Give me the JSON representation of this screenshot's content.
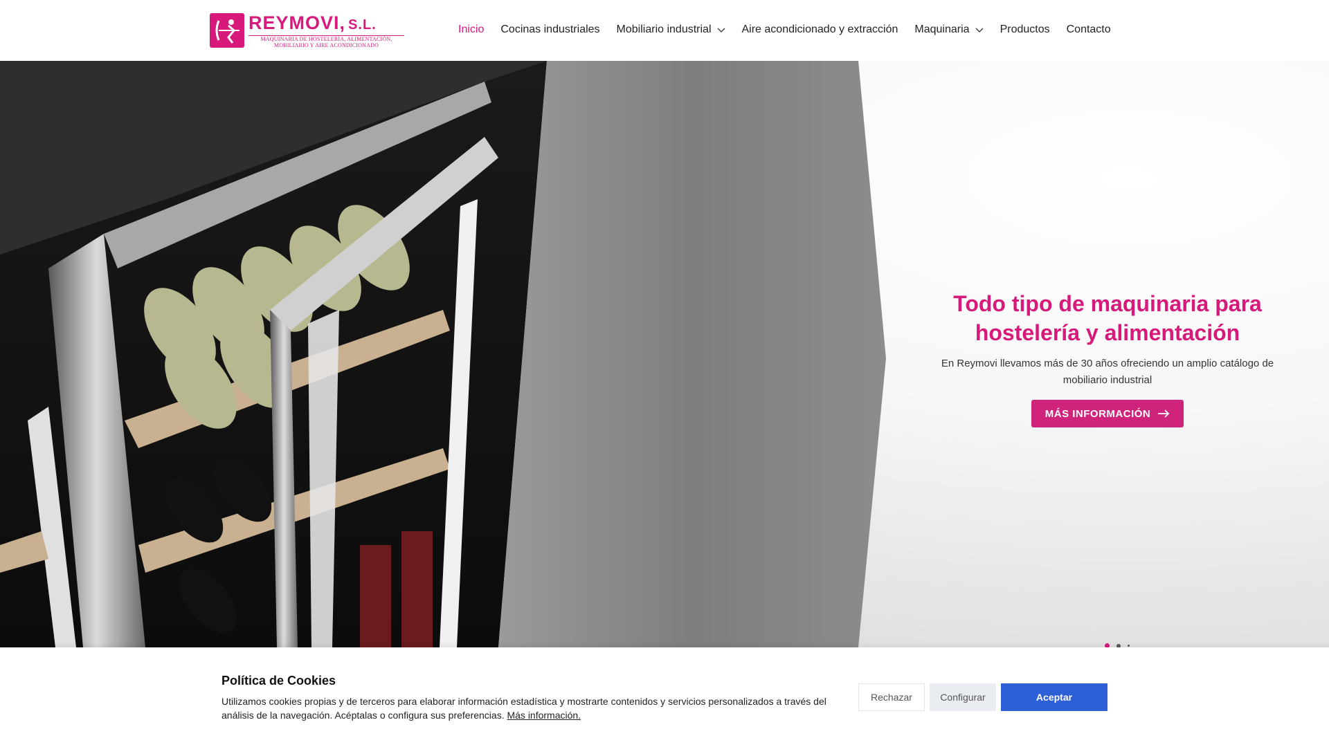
{
  "header": {
    "logo": {
      "name": "REYMOVI",
      "suffix": "S.L.",
      "subtitle_1": "MAQUINARIA DE HOSTELERÍA, ALIMENTACIÓN,",
      "subtitle_2": "MOBILIARIO Y AIRE ACONDICIONADO"
    },
    "nav": [
      {
        "label": "Inicio",
        "active": true
      },
      {
        "label": "Cocinas industriales"
      },
      {
        "label": "Mobiliario industrial",
        "dropdown": true
      },
      {
        "label": "Aire acondicionado y extracción"
      },
      {
        "label": "Maquinaria",
        "dropdown": true
      },
      {
        "label": "Productos"
      },
      {
        "label": "Contacto"
      }
    ]
  },
  "hero": {
    "title_line1": "Todo tipo de maquinaria para",
    "title_line2": "hostelería y alimentación",
    "description": "En Reymovi llevamos más de 30 años ofreciendo un amplio catálogo de mobiliario industrial",
    "button_label": "MÁS INFORMACIÓN",
    "slides_total": 3,
    "active_slide": 1
  },
  "cookie": {
    "title": "Política de Cookies",
    "text": "Utilizamos cookies propias y de terceros para elaborar información estadística y mostrarte contenidos y servicios personalizados a través del análisis de la navegación. Acéptalas o configura sus preferencias. ",
    "link": "Más información.",
    "reject": "Rechazar",
    "configure": "Configurar",
    "accept": "Aceptar"
  },
  "colors": {
    "brand": "#d6197a",
    "accept": "#2d5fd6"
  }
}
